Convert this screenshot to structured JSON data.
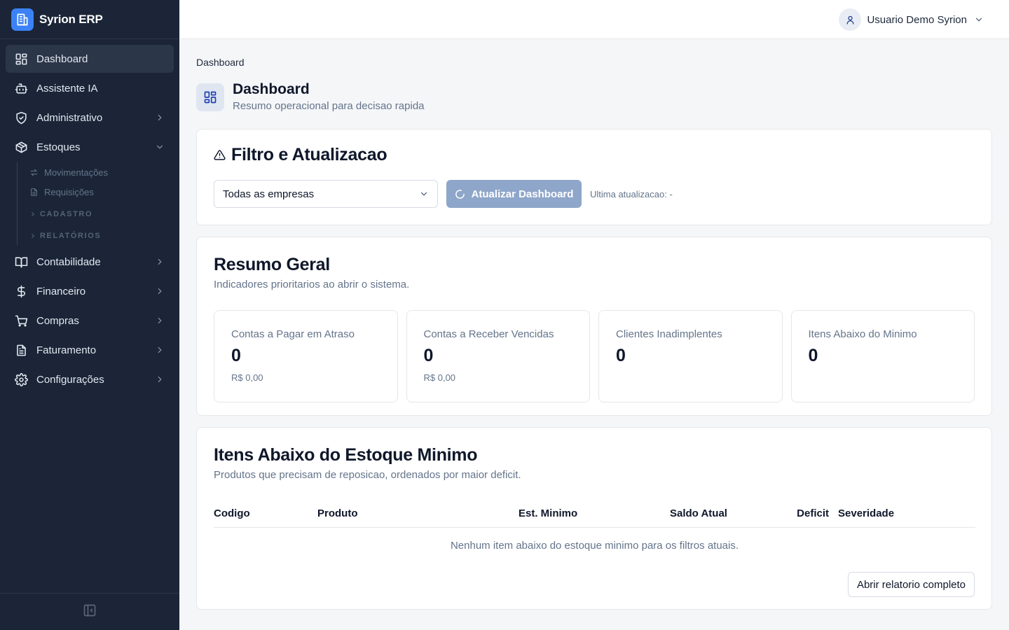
{
  "brand": {
    "name": "Syrion ERP",
    "icon": "building-icon",
    "accent": "#3b82f6"
  },
  "sidebar": {
    "items": [
      {
        "label": "Dashboard",
        "icon": "dashboard-grid-icon",
        "active": true
      },
      {
        "label": "Assistente IA",
        "icon": "bot-icon"
      },
      {
        "label": "Administrativo",
        "icon": "shield-icon",
        "expandable": true
      },
      {
        "label": "Estoques",
        "icon": "package-icon",
        "expanded": true
      },
      {
        "label": "Contabilidade",
        "icon": "book-icon",
        "expandable": true
      },
      {
        "label": "Financeiro",
        "icon": "dollar-icon",
        "expandable": true
      },
      {
        "label": "Compras",
        "icon": "cart-icon",
        "expandable": true
      },
      {
        "label": "Faturamento",
        "icon": "file-text-icon",
        "expandable": true
      },
      {
        "label": "Configurações",
        "icon": "gear-icon",
        "expandable": true
      }
    ],
    "estoques_sub": {
      "movimentacoes": "Movimentações",
      "requisicoes": "Requisições",
      "cadastro": "CADASTRO",
      "relatorios": "RELATÓRIOS"
    },
    "footer_icon": "panel-collapse-icon",
    "bg": "#1b2537"
  },
  "header": {
    "user_name": "Usuario Demo Syrion",
    "user_icon": "user-icon"
  },
  "breadcrumb": "Dashboard",
  "page": {
    "title": "Dashboard",
    "subtitle": "Resumo operacional para decisao rapida"
  },
  "filter": {
    "title": "Filtro e Atualizacao",
    "title_icon": "warning-triangle-icon",
    "company_select": "Todas as empresas",
    "refresh_button": "Atualizar Dashboard",
    "last_update": "Ultima atualizacao: -"
  },
  "summary": {
    "title": "Resumo Geral",
    "subtitle": "Indicadores prioritarios ao abrir o sistema.",
    "kpis": [
      {
        "label": "Contas a Pagar em Atraso",
        "value": "0",
        "note": "R$ 0,00"
      },
      {
        "label": "Contas a Receber Vencidas",
        "value": "0",
        "note": "R$ 0,00"
      },
      {
        "label": "Clientes Inadimplentes",
        "value": "0",
        "note": ""
      },
      {
        "label": "Itens Abaixo do Minimo",
        "value": "0",
        "note": ""
      }
    ]
  },
  "stock": {
    "title": "Itens Abaixo do Estoque Minimo",
    "subtitle": "Produtos que precisam de reposicao, ordenados por maior deficit.",
    "columns": [
      "Codigo",
      "Produto",
      "Est. Minimo",
      "Saldo Atual",
      "Deficit",
      "Severidade"
    ],
    "empty_message": "Nenhum item abaixo do estoque minimo para os filtros atuais.",
    "open_report_button": "Abrir relatorio completo"
  }
}
